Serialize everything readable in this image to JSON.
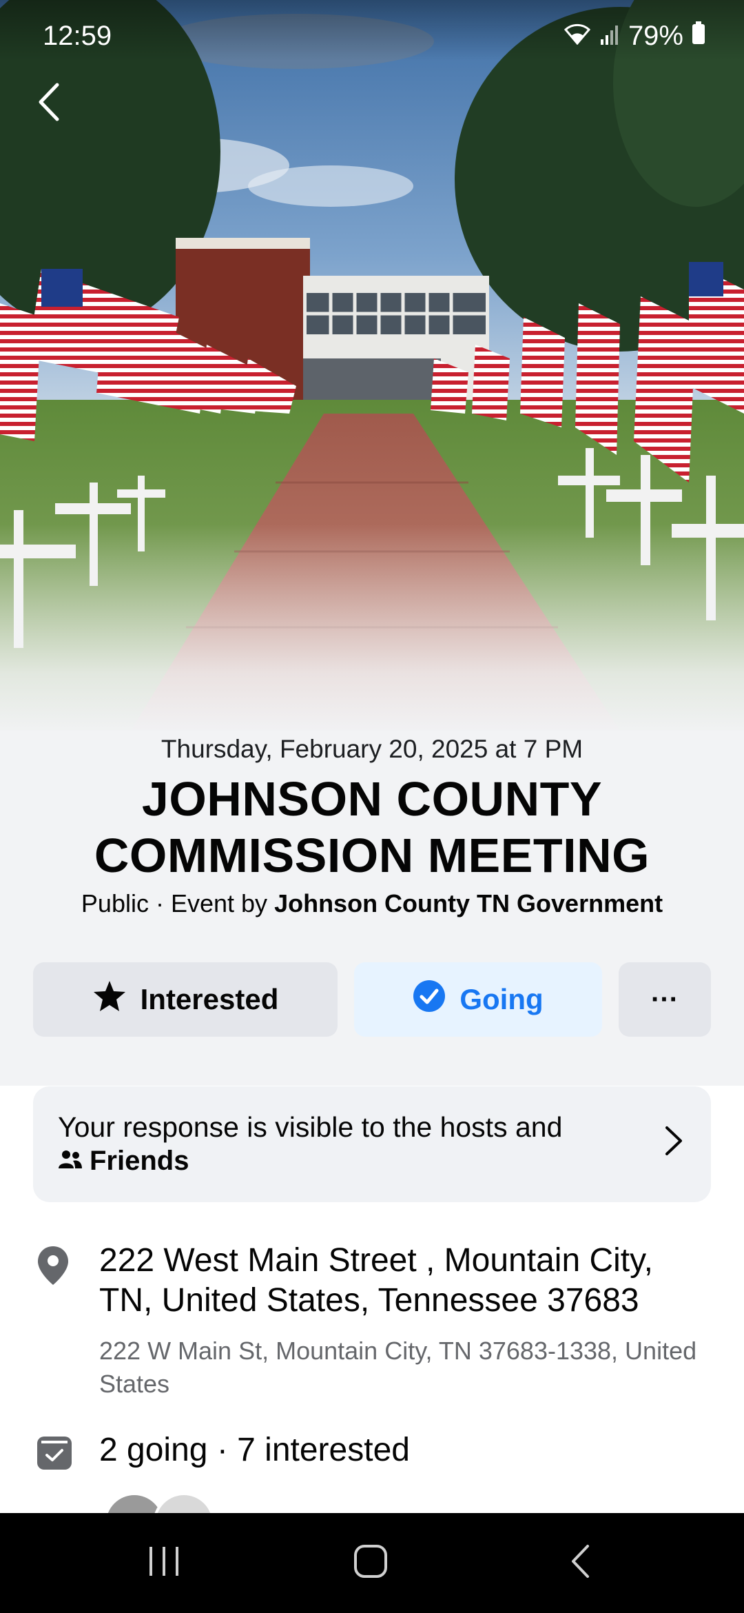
{
  "status_bar": {
    "time": "12:59",
    "battery": "79%"
  },
  "event": {
    "date": "Thursday, February 20, 2025 at 7 PM",
    "title": "JOHNSON COUNTY COMMISSION MEETING",
    "privacy": "Public",
    "separator": " · ",
    "event_by_prefix": "Event by ",
    "host": "Johnson County TN Government"
  },
  "actions": {
    "interested_label": "Interested",
    "going_label": "Going",
    "more_label": "···"
  },
  "visibility": {
    "line1": "Your response is visible to the hosts and",
    "audience": "Friends"
  },
  "location": {
    "main": "222 West Main Street , Mountain City, TN, United States, Tennessee 37683",
    "sub": "222 W Main St, Mountain City, TN 37683-1338, United States"
  },
  "attendance": {
    "summary": "2 going · 7 interested"
  },
  "colors": {
    "accent": "#1877f2",
    "accent_bg": "#e7f3ff",
    "button_bg": "#e4e6eb",
    "card_bg": "#f0f2f5"
  },
  "icons": {
    "back": "chevron-left-icon",
    "interested": "star-icon",
    "going": "check-circle-icon",
    "friends": "people-icon",
    "location": "map-pin-icon",
    "attendance": "calendar-check-icon"
  }
}
